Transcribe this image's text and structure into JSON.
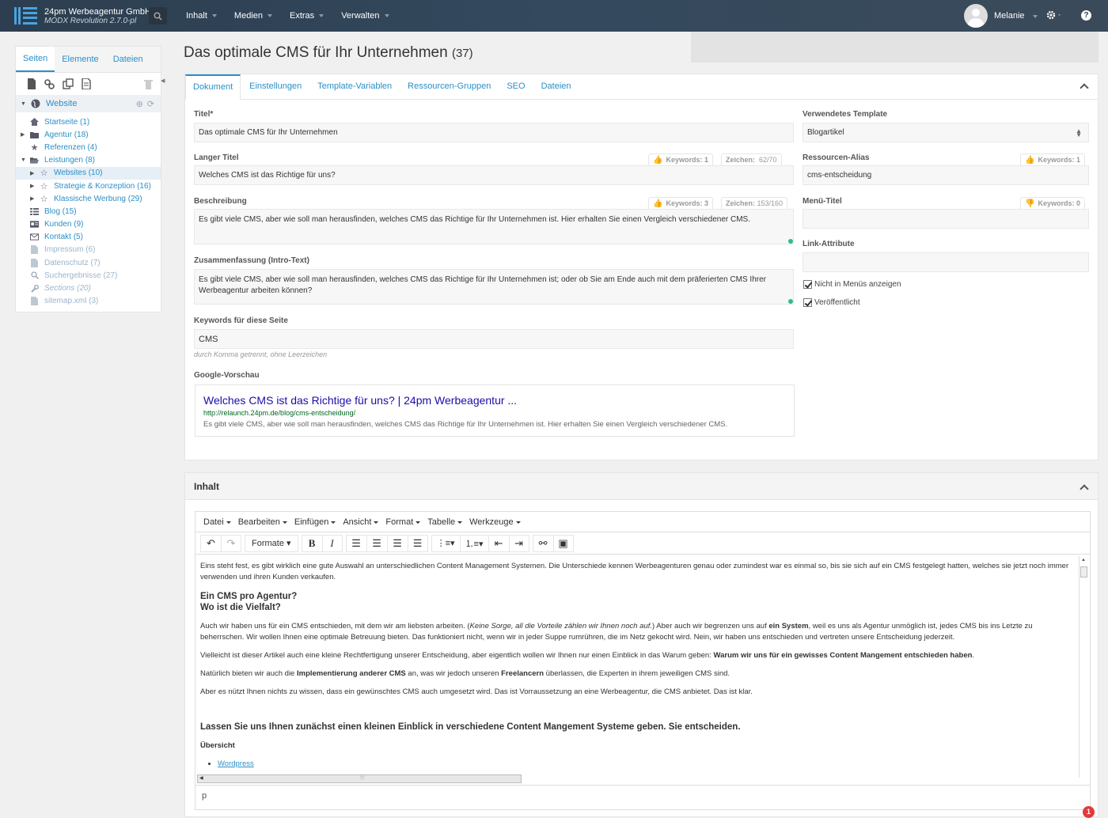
{
  "topbar": {
    "site_name": "24pm Werbeagentur GmbH",
    "version": "MODX Revolution 2.7.0-pl",
    "nav": [
      "Inhalt",
      "Medien",
      "Extras",
      "Verwalten"
    ],
    "user": "Melanie",
    "help": "?"
  },
  "sidebar": {
    "tabs": [
      "Seiten",
      "Elemente",
      "Dateien"
    ],
    "root": "Website",
    "tree": [
      {
        "label": "Startseite (1)",
        "icon": "home-icon",
        "level": 0,
        "caret": ""
      },
      {
        "label": "Agentur (18)",
        "icon": "folder-icon",
        "level": 0,
        "caret": "right"
      },
      {
        "label": "Referenzen (4)",
        "icon": "star-icon",
        "level": 0,
        "caret": ""
      },
      {
        "label": "Leistungen (8)",
        "icon": "folder-open-icon",
        "level": 0,
        "caret": "down"
      },
      {
        "label": "Websites (10)",
        "icon": "star-outline-icon",
        "level": 1,
        "caret": "right",
        "selected": true
      },
      {
        "label": "Strategie & Konzeption (16)",
        "icon": "star-outline-icon",
        "level": 1,
        "caret": "right"
      },
      {
        "label": "Klassische Werbung (29)",
        "icon": "star-outline-icon",
        "level": 1,
        "caret": "right"
      },
      {
        "label": "Blog (15)",
        "icon": "grid-icon",
        "level": 0,
        "caret": ""
      },
      {
        "label": "Kunden (9)",
        "icon": "card-icon",
        "level": 0,
        "caret": ""
      },
      {
        "label": "Kontakt (5)",
        "icon": "envelope-icon",
        "level": 0,
        "caret": ""
      },
      {
        "label": "Impressum (6)",
        "icon": "page-icon",
        "level": 0,
        "caret": "",
        "style": "grey"
      },
      {
        "label": "Datenschutz (7)",
        "icon": "page-icon",
        "level": 0,
        "caret": "",
        "style": "grey"
      },
      {
        "label": "Suchergebnisse (27)",
        "icon": "search-icon",
        "level": 0,
        "caret": "",
        "style": "grey"
      },
      {
        "label": "Sections (20)",
        "icon": "wrench-icon",
        "level": 0,
        "caret": "",
        "style": "italic"
      },
      {
        "label": "sitemap.xml (3)",
        "icon": "page-icon",
        "level": 0,
        "caret": "",
        "style": "grey"
      }
    ]
  },
  "page": {
    "title": "Das optimale CMS für Ihr Unternehmen",
    "id": "(37)",
    "tabs": [
      "Dokument",
      "Einstellungen",
      "Template-Variablen",
      "Ressourcen-Gruppen",
      "SEO",
      "Dateien"
    ]
  },
  "form": {
    "titel_label": "Titel*",
    "titel_value": "Das optimale CMS für Ihr Unternehmen",
    "langer_titel_label": "Langer Titel",
    "langer_titel_value": "Welches CMS ist das Richtige für uns?",
    "langer_keywords": "Keywords: 1",
    "langer_zeichen_label": "Zeichen:",
    "langer_zeichen": "62/70",
    "beschreibung_label": "Beschreibung",
    "beschreibung_value": "Es gibt viele CMS, aber wie soll man herausfinden, welches CMS das Richtige für Ihr Unternehmen ist. Hier erhalten Sie einen Vergleich verschiedener CMS.",
    "beschreibung_keywords": "Keywords: 3",
    "beschreibung_zeichen_label": "Zeichen:",
    "beschreibung_zeichen": "153/160",
    "zusammenfassung_label": "Zusammenfassung (Intro-Text)",
    "zusammenfassung_value": "Es gibt viele CMS, aber wie soll man herausfinden, welches CMS das Richtige für Ihr Unternehmen ist; oder ob Sie am Ende auch mit dem präferierten CMS Ihrer Werbeagentur arbeiten können?",
    "keywords_label": "Keywords für diese Seite",
    "keywords_value": "CMS",
    "keywords_hint": "durch Komma getrennt, ohne Leerzeichen",
    "google_label": "Google-Vorschau",
    "google_title": "Welches CMS ist das Richtige für uns? | 24pm Werbeagentur ...",
    "google_url": "http://relaunch.24pm.de/blog/cms-entscheidung/",
    "google_desc": "Es gibt viele CMS, aber wie soll man herausfinden, welches CMS das Richtige für Ihr Unternehmen ist. Hier erhalten Sie einen Vergleich verschiedener CMS.",
    "template_label": "Verwendetes Template",
    "template_value": "Blogartikel",
    "alias_label": "Ressourcen-Alias",
    "alias_value": "cms-entscheidung",
    "alias_keywords": "Keywords: 1",
    "menutitel_label": "Menü-Titel",
    "menutitel_value": "",
    "menutitel_keywords": "Keywords: 0",
    "linkattr_label": "Link-Attribute",
    "linkattr_value": "",
    "hide_menu": "Nicht in Menüs anzeigen",
    "published": "Veröffentlicht"
  },
  "content_panel": {
    "title": "Inhalt",
    "menu": [
      "Datei",
      "Bearbeiten",
      "Einfügen",
      "Ansicht",
      "Format",
      "Tabelle",
      "Werkzeuge"
    ],
    "formats_label": "Formate",
    "status_path": "p",
    "notification_count": "1",
    "p1": "Eins steht fest, es gibt wirklich eine gute Auswahl an unterschiedlichen Content Management Systemen. Die Unterschiede kennen Werbeagenturen genau oder zumindest war es einmal so, bis sie sich auf ein CMS festgelegt hatten, welches sie jetzt noch immer verwenden und ihren Kunden verkaufen.",
    "h1a": "Ein CMS pro Agentur?",
    "h1b": "Wo ist die Vielfalt?",
    "p2a": "Auch wir haben uns für ein CMS entschieden, mit dem wir am liebsten arbeiten. (",
    "p2b": "Keine Sorge, all die Vorteile zählen wir Ihnen noch auf.",
    "p2c": ") Aber auch wir begrenzen uns auf ",
    "p2d": "ein System",
    "p2e": ", weil es uns als Agentur unmöglich ist, jedes CMS bis ins Letzte zu beherrschen. Wir wollen Ihnen eine optimale Betreuung bieten. Das funktioniert nicht, wenn wir in jeder Suppe rumrühren, die im Netz gekocht wird. Nein, wir haben uns entschieden und vertreten unsere Entscheidung jederzeit.",
    "p3a": "Vielleicht ist dieser Artikel auch eine kleine Rechtfertigung unserer Entscheidung, aber eigentlich wollen wir Ihnen nur einen Einblick in das Warum geben: ",
    "p3b": "Warum wir uns für ein gewisses Content Mangement entschieden haben",
    "p3c": ".",
    "p4a": "Natürlich bieten wir auch die ",
    "p4b": "Implementierung anderer CMS",
    "p4c": " an, was wir jedoch unseren ",
    "p4d": "Freelancern",
    "p4e": " überlassen, die Experten in ihrem jeweiligen CMS sind.",
    "p5": "Aber es nützt Ihnen nichts zu wissen, dass ein gewünschtes CMS auch umgesetzt wird. Das ist Vorraussetzung an eine Werbeagentur, die CMS anbietet. Das ist klar.",
    "h2": "Lassen Sie uns Ihnen zunächst einen kleinen Einblick in verschiedene Content Mangement Systeme geben. Sie entscheiden.",
    "h3": "Übersicht",
    "li1": "Wordpress"
  },
  "colors": {
    "accent": "#2a8fc7",
    "topbar": "#2c3e4f",
    "ok_dot": "#2ebd8a",
    "badge_red": "#e23a3a",
    "link": "#1a0dab",
    "url_green": "#006621"
  }
}
